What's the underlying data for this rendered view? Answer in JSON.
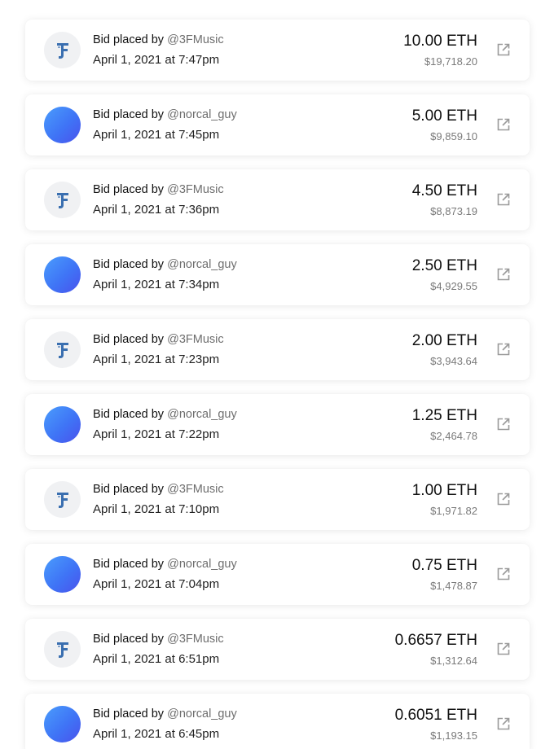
{
  "bid_prefix": "Bid placed by",
  "bids": [
    {
      "bidder": "@3FMusic",
      "avatar": "3f-logo",
      "time": "April 1, 2021 at 7:47pm",
      "eth": "10.00 ETH",
      "usd": "$19,718.20"
    },
    {
      "bidder": "@norcal_guy",
      "avatar": "blue-gradient",
      "time": "April 1, 2021 at 7:45pm",
      "eth": "5.00 ETH",
      "usd": "$9,859.10"
    },
    {
      "bidder": "@3FMusic",
      "avatar": "3f-logo",
      "time": "April 1, 2021 at 7:36pm",
      "eth": "4.50 ETH",
      "usd": "$8,873.19"
    },
    {
      "bidder": "@norcal_guy",
      "avatar": "blue-gradient",
      "time": "April 1, 2021 at 7:34pm",
      "eth": "2.50 ETH",
      "usd": "$4,929.55"
    },
    {
      "bidder": "@3FMusic",
      "avatar": "3f-logo",
      "time": "April 1, 2021 at 7:23pm",
      "eth": "2.00 ETH",
      "usd": "$3,943.64"
    },
    {
      "bidder": "@norcal_guy",
      "avatar": "blue-gradient",
      "time": "April 1, 2021 at 7:22pm",
      "eth": "1.25 ETH",
      "usd": "$2,464.78"
    },
    {
      "bidder": "@3FMusic",
      "avatar": "3f-logo",
      "time": "April 1, 2021 at 7:10pm",
      "eth": "1.00 ETH",
      "usd": "$1,971.82"
    },
    {
      "bidder": "@norcal_guy",
      "avatar": "blue-gradient",
      "time": "April 1, 2021 at 7:04pm",
      "eth": "0.75 ETH",
      "usd": "$1,478.87"
    },
    {
      "bidder": "@3FMusic",
      "avatar": "3f-logo",
      "time": "April 1, 2021 at 6:51pm",
      "eth": "0.6657 ETH",
      "usd": "$1,312.64"
    },
    {
      "bidder": "@norcal_guy",
      "avatar": "blue-gradient",
      "time": "April 1, 2021 at 6:45pm",
      "eth": "0.6051 ETH",
      "usd": "$1,193.15"
    }
  ],
  "icons": {
    "external_link": "external-link-icon",
    "logo_color": "#3a6fb0",
    "gradient_from": "#4a9dfc",
    "gradient_to": "#4a52ec"
  }
}
